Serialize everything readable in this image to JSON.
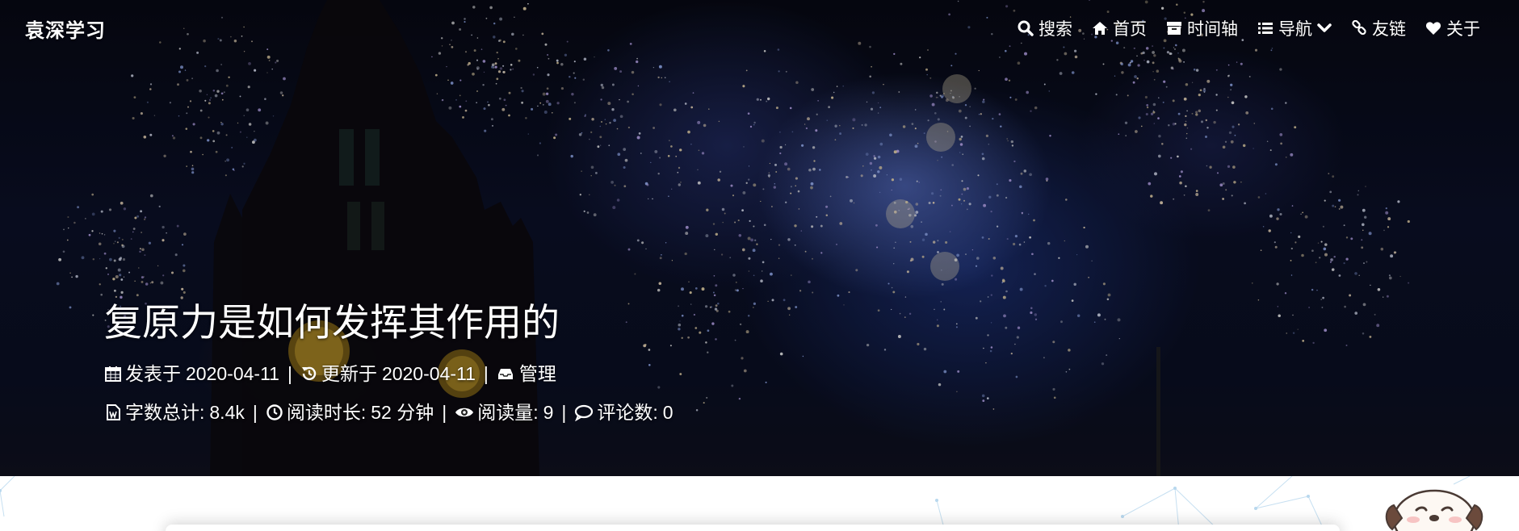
{
  "site": {
    "brand": "袁深学习"
  },
  "nav": {
    "items": [
      {
        "icon": "search-icon",
        "label": "搜索"
      },
      {
        "icon": "home-icon",
        "label": "首页"
      },
      {
        "icon": "archive-icon",
        "label": "时间轴"
      },
      {
        "icon": "list-icon",
        "label": "导航"
      },
      {
        "icon": "link-icon",
        "label": "友链"
      },
      {
        "icon": "heart-icon",
        "label": "关于"
      }
    ]
  },
  "post": {
    "title": "复原力是如何发挥其作用的",
    "published_label": "发表于",
    "published_date": "2020-04-11",
    "updated_label": "更新于",
    "updated_date": "2020-04-11",
    "category": "管理",
    "word_count_label": "字数总计:",
    "word_count": "8.4k",
    "read_time_label": "阅读时长:",
    "read_time": "52 分钟",
    "views_label": "阅读量:",
    "views": "9",
    "comments_label": "评论数:",
    "comments": "0",
    "separator": "|"
  },
  "colors": {
    "text": "#ffffff",
    "hero_bg": "#0b1028"
  }
}
